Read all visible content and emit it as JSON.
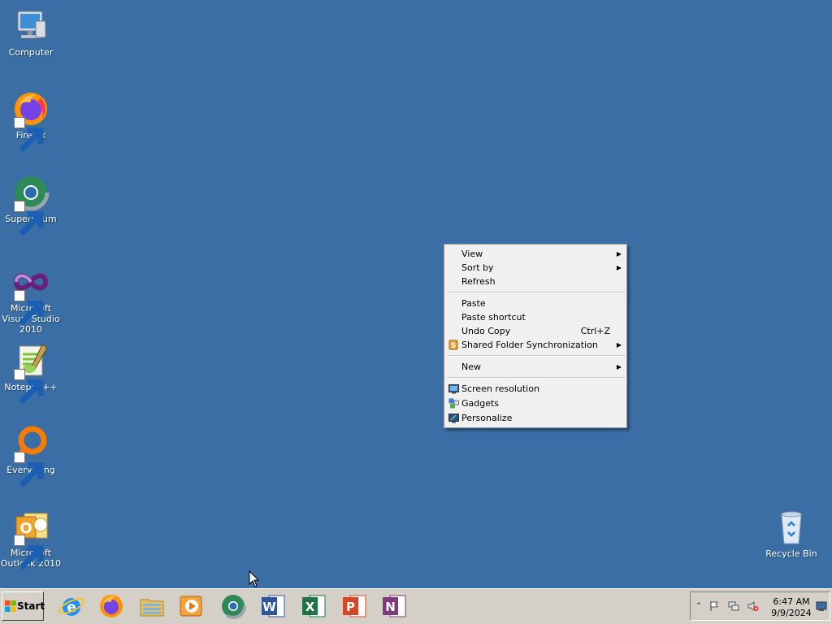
{
  "desktop": {
    "background": "#3a6ea5",
    "icons": [
      {
        "label": "Computer",
        "icon": "computer-icon",
        "shortcut": false
      },
      {
        "label": "Firefox",
        "icon": "firefox-icon",
        "shortcut": true
      },
      {
        "label": "Supermium",
        "icon": "supermium-icon",
        "shortcut": true
      },
      {
        "label": "Microsoft Visual Studio 2010",
        "icon": "visual-studio-icon",
        "shortcut": true
      },
      {
        "label": "Notepad++",
        "icon": "notepadpp-icon",
        "shortcut": true
      },
      {
        "label": "Everything",
        "icon": "everything-icon",
        "shortcut": true
      },
      {
        "label": "Microsoft Outlook 2010",
        "icon": "outlook-icon",
        "shortcut": true
      },
      {
        "label": "Recycle Bin",
        "icon": "recycle-bin-icon",
        "shortcut": false
      }
    ]
  },
  "context_menu": {
    "items": [
      {
        "label": "View",
        "submenu": true
      },
      {
        "label": "Sort by",
        "submenu": true
      },
      {
        "label": "Refresh"
      },
      {
        "label": "Paste"
      },
      {
        "label": "Paste shortcut"
      },
      {
        "label": "Undo Copy",
        "accelerator": "Ctrl+Z"
      },
      {
        "label": "Shared Folder Synchronization",
        "submenu": true,
        "icon": "sync-icon"
      },
      {
        "label": "New",
        "submenu": true
      },
      {
        "label": "Screen resolution",
        "icon": "screen-resolution-icon"
      },
      {
        "label": "Gadgets",
        "icon": "gadgets-icon"
      },
      {
        "label": "Personalize",
        "icon": "personalize-icon"
      }
    ]
  },
  "taskbar": {
    "start_label": "Start",
    "pinned": [
      {
        "name": "Internet Explorer",
        "icon": "ie-icon"
      },
      {
        "name": "Firefox",
        "icon": "firefox-icon"
      },
      {
        "name": "Windows Explorer",
        "icon": "explorer-icon"
      },
      {
        "name": "Windows Media Player",
        "icon": "media-player-icon"
      },
      {
        "name": "Supermium",
        "icon": "supermium-icon"
      },
      {
        "name": "Microsoft Word",
        "icon": "word-icon"
      },
      {
        "name": "Microsoft Excel",
        "icon": "excel-icon"
      },
      {
        "name": "Microsoft PowerPoint",
        "icon": "powerpoint-icon"
      },
      {
        "name": "Microsoft OneNote",
        "icon": "onenote-icon"
      }
    ],
    "tray": {
      "time": "6:47 AM",
      "date": "9/9/2024"
    }
  }
}
